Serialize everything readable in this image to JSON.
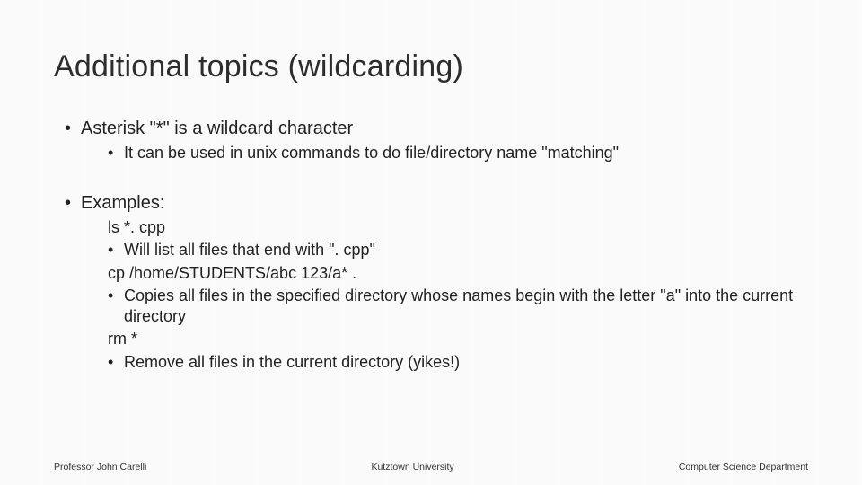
{
  "title": "Additional topics (wildcarding)",
  "b1": "Asterisk \"*\" is a wildcard character",
  "b1a": "It can be used in unix commands to do file/directory name \"matching\"",
  "b2": "Examples:",
  "ex1": "ls *. cpp",
  "ex1a": "Will list all files that end with \". cpp\"",
  "ex2": "cp /home/STUDENTS/abc 123/a* .",
  "ex2a": "Copies all files in the specified directory whose names begin with the letter \"a\" into the current directory",
  "ex3": "rm *",
  "ex3a": "Remove all files in the current directory (yikes!)",
  "footer": {
    "left": "Professor John Carelli",
    "center": "Kutztown University",
    "right": "Computer Science Department"
  }
}
